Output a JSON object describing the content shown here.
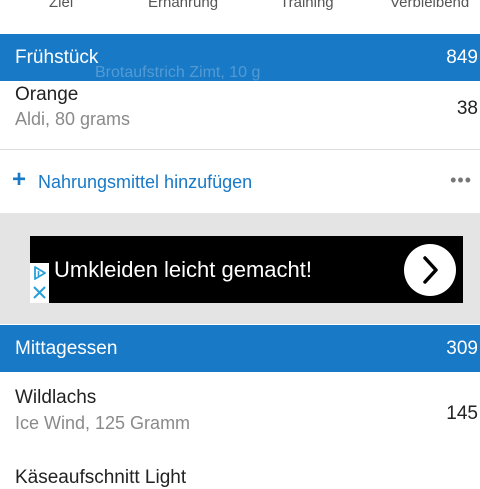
{
  "summary": {
    "goal_label": "Ziel",
    "food_label": "Ernährung",
    "exercise_label": "Training",
    "remaining_label": "Verbleibend"
  },
  "breakfast": {
    "title": "Frühstück",
    "calories": "849",
    "ghost_text": "Brotaufstrich Zimt, 10 g",
    "items": [
      {
        "name": "Orange",
        "detail": "Aldi, 80 grams",
        "calories": "38"
      }
    ],
    "add_label": "Nahrungsmittel hinzufügen",
    "more_icon": "more-horizontal-icon"
  },
  "ad": {
    "text": "Umkleiden leicht gemacht!",
    "icons": [
      "adchoices-icon",
      "close-icon",
      "chevron-right-icon"
    ]
  },
  "lunch": {
    "title": "Mittagessen",
    "calories": "309",
    "items": [
      {
        "name": "Wildlachs",
        "detail": "Ice Wind, 125 Gramm",
        "calories": "145"
      },
      {
        "name": "Käseaufschnitt Light"
      }
    ]
  },
  "colors": {
    "accent": "#1879c6",
    "ad_background": "#000000",
    "separator_area": "#e4e4e4"
  }
}
